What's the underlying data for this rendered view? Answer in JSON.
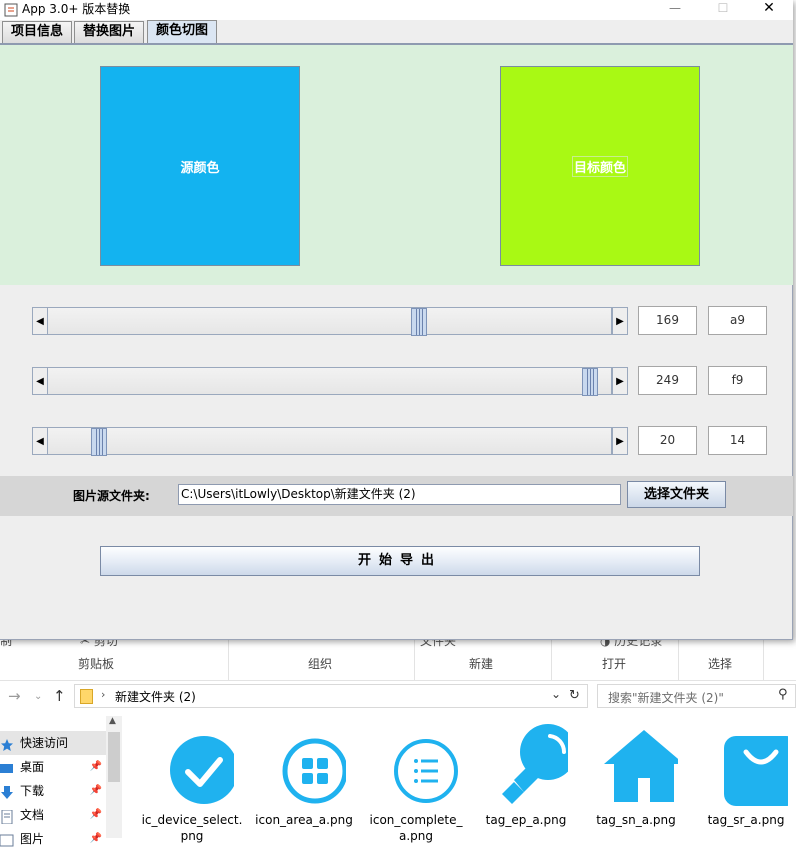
{
  "app": {
    "title": "App 3.0+ 版本替换",
    "window_controls": {
      "minimize": "—",
      "maximize": "☐",
      "close": "✕"
    },
    "tabs": [
      {
        "label": "项目信息",
        "active": false
      },
      {
        "label": "替换图片",
        "active": false
      },
      {
        "label": "颜色切图",
        "active": true
      }
    ],
    "source_color": {
      "label": "源颜色",
      "hex": "#13b3f0"
    },
    "target_color": {
      "label": "目标颜色",
      "hex": "#a9f914"
    },
    "sliders": [
      {
        "value": 169,
        "max": 255,
        "decimal": "169",
        "hex": "a9"
      },
      {
        "value": 249,
        "max": 255,
        "decimal": "249",
        "hex": "f9"
      },
      {
        "value": 20,
        "max": 255,
        "decimal": "20",
        "hex": "14"
      }
    ],
    "folder": {
      "label": "图片源文件夹:",
      "path": "C:\\Users\\itLowly\\Desktop\\新建文件夹 (2)",
      "button": "选择文件夹"
    },
    "export_button": "开始导出"
  },
  "explorer": {
    "ribbon": {
      "groups": [
        "剪贴板",
        "组织",
        "新建",
        "打开",
        "选择"
      ],
      "partial_items": [
        "剪切",
        "文件夹",
        "历史记录"
      ]
    },
    "address": {
      "current_folder": "新建文件夹 (2)",
      "search_placeholder": "搜索\"新建文件夹 (2)\""
    },
    "nav_items": [
      {
        "label": "快速访问",
        "selected": true,
        "icon": "star-icon"
      },
      {
        "label": "桌面",
        "selected": false,
        "icon": "desktop-icon"
      },
      {
        "label": "下载",
        "selected": false,
        "icon": "download-icon"
      },
      {
        "label": "文档",
        "selected": false,
        "icon": "document-icon"
      },
      {
        "label": "图片",
        "selected": false,
        "icon": "picture-icon"
      }
    ],
    "files": [
      {
        "name": "ic_device_select.",
        "name2": "png",
        "icon": "check-icon"
      },
      {
        "name": "icon_area_a.png",
        "name2": "",
        "icon": "grid-icon"
      },
      {
        "name": "icon_complete_",
        "name2": "a.png",
        "icon": "list-icon"
      },
      {
        "name": "tag_ep_a.png",
        "name2": "",
        "icon": "bulb-icon"
      },
      {
        "name": "tag_sn_a.png",
        "name2": "",
        "icon": "home-icon"
      },
      {
        "name": "tag_sr_a.png",
        "name2": "",
        "icon": "bag-icon"
      }
    ],
    "icon_color": "#1fb2ef"
  }
}
